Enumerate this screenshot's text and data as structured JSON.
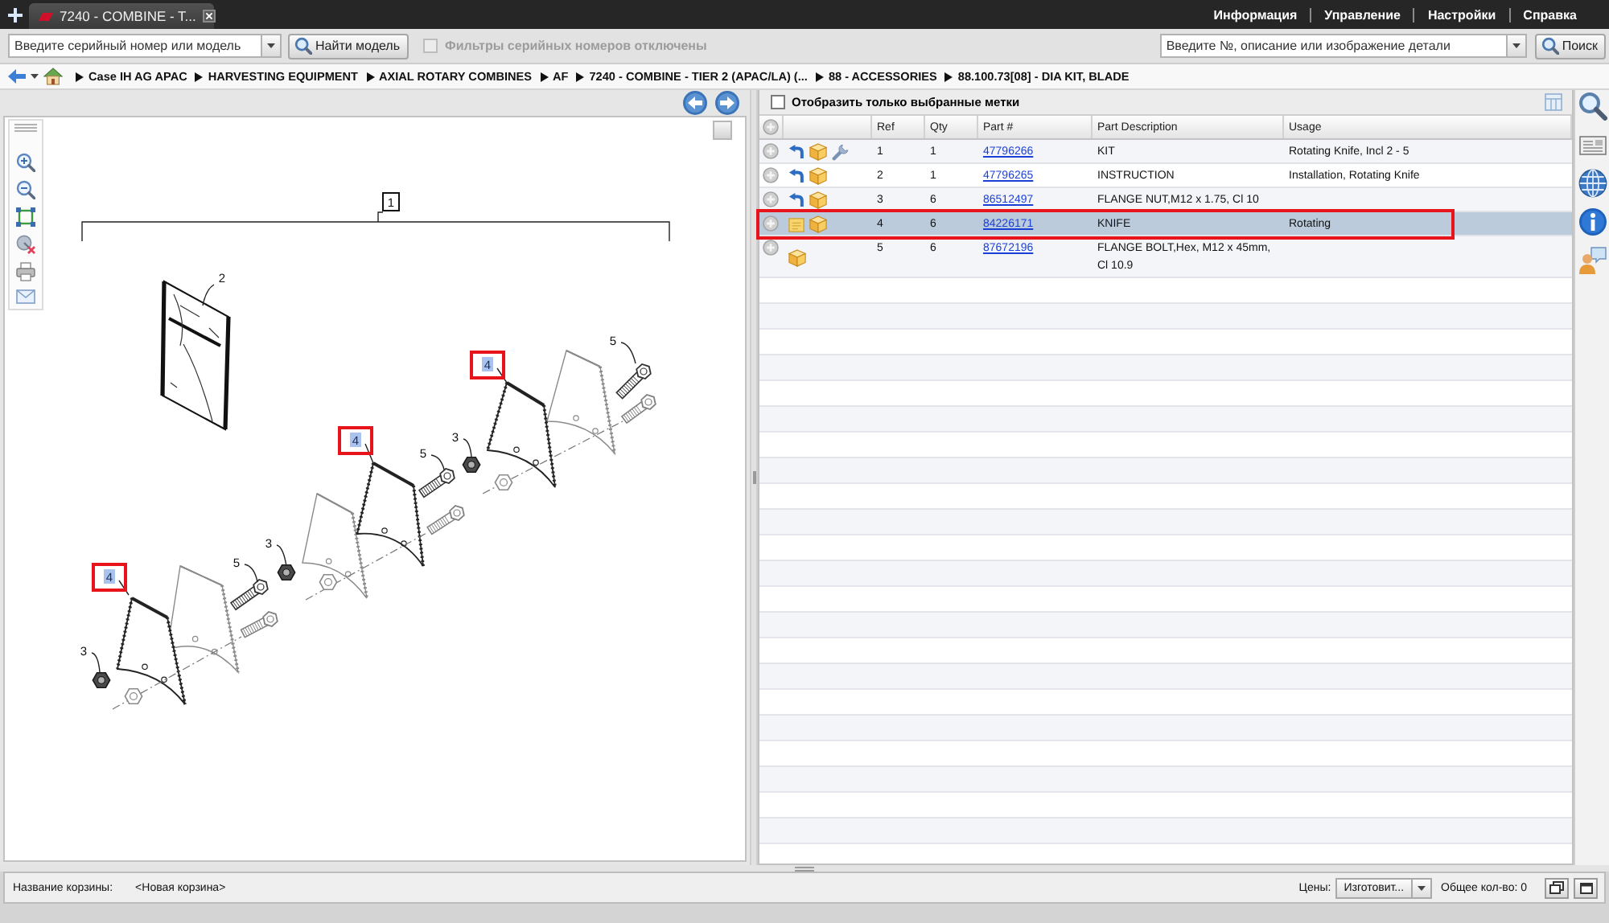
{
  "window": {
    "tab_title": "7240 - COMBINE - T...",
    "menu_links": [
      "Информация",
      "Управление",
      "Настройки",
      "Справка"
    ]
  },
  "toolbar": {
    "serial_field": {
      "placeholder": "Введите серийный номер или модель"
    },
    "find_model_button": "Найти модель",
    "serial_filter": {
      "label": "Фильтры серийных номеров отключены",
      "checked": false,
      "disabled": true
    },
    "part_search": {
      "placeholder": "Введите №, описание или изображение детали"
    },
    "search_button": "Поиск"
  },
  "breadcrumb": [
    "Case IH AG APAC",
    "HARVESTING EQUIPMENT",
    "AXIAL ROTARY COMBINES",
    "AF",
    "7240 - COMBINE - TIER 2 (APAC/LA) (...",
    "88 - ACCESSORIES",
    "88.100.73[08] - DIA KIT, BLADE"
  ],
  "diagram": {
    "callouts": [
      {
        "label": "1",
        "kind": "boxed",
        "selected": false,
        "marked": false
      },
      {
        "label": "2",
        "kind": "plain",
        "selected": false,
        "marked": false
      },
      {
        "label": "5",
        "kind": "plain",
        "selected": false,
        "marked": false
      },
      {
        "label": "4",
        "kind": "plain",
        "selected": true,
        "marked": true
      },
      {
        "label": "3",
        "kind": "plain",
        "selected": false,
        "marked": false
      },
      {
        "label": "4",
        "kind": "plain",
        "selected": true,
        "marked": true
      },
      {
        "label": "5",
        "kind": "plain",
        "selected": false,
        "marked": false
      },
      {
        "label": "3",
        "kind": "plain",
        "selected": false,
        "marked": false
      },
      {
        "label": "5",
        "kind": "plain",
        "selected": false,
        "marked": false
      },
      {
        "label": "4",
        "kind": "plain",
        "selected": true,
        "marked": true
      },
      {
        "label": "3",
        "kind": "plain",
        "selected": false,
        "marked": false
      }
    ]
  },
  "parts": {
    "filter": {
      "label": "Отобразить только выбранные метки",
      "checked": false
    },
    "table": {
      "columns": [
        "Ref",
        "Qty",
        "Part #",
        "Part Description",
        "Usage"
      ],
      "rows": [
        {
          "icons": [
            {
              "kind": "arrow"
            },
            {
              "kind": "box"
            },
            {
              "kind": "wrench"
            }
          ],
          "ref": "1",
          "qty": "1",
          "part_no": "47796266",
          "description": "KIT",
          "usage": "Rotating Knife, Incl 2 - 5",
          "selected": false,
          "marked": false
        },
        {
          "icons": [
            {
              "kind": "arrow"
            },
            {
              "kind": "box"
            }
          ],
          "ref": "2",
          "qty": "1",
          "part_no": "47796265",
          "description": "INSTRUCTION",
          "usage": "Installation, Rotating Knife",
          "selected": false,
          "marked": false
        },
        {
          "icons": [
            {
              "kind": "arrow"
            },
            {
              "kind": "box"
            }
          ],
          "ref": "3",
          "qty": "6",
          "part_no": "86512497",
          "description": "FLANGE NUT,M12 x 1.75, Cl 10",
          "selected": false,
          "marked": false
        },
        {
          "icons": [
            {
              "kind": "note"
            },
            {
              "kind": "box"
            }
          ],
          "ref": "4",
          "qty": "6",
          "part_no": "84226171",
          "description": "KNIFE",
          "usage": "Rotating",
          "selected": true,
          "marked": true
        },
        {
          "icons": [
            {
              "kind": "box"
            }
          ],
          "ref": "5",
          "qty": "6",
          "part_no": "87672196",
          "description": "FLANGE BOLT,Hex, M12 x 45mm, Cl 10.9",
          "selected": false,
          "marked": false
        }
      ]
    }
  },
  "basket": {
    "name_label": "Название корзины:",
    "name": "<Новая корзина>",
    "price_label": "Цены:",
    "price_mode": "Изготовит...",
    "total": "Общее кол-во: 0"
  }
}
